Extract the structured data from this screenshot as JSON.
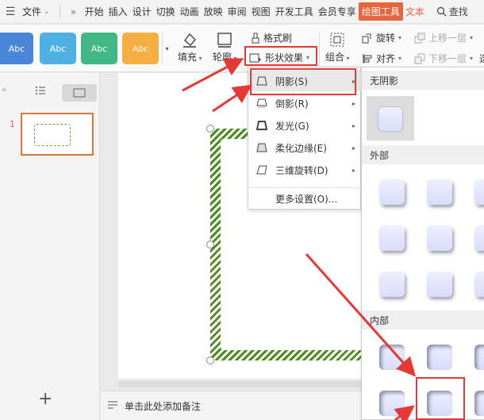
{
  "menubar": {
    "file": "文件",
    "tabs": [
      "开始",
      "插入",
      "设计",
      "切换",
      "动画",
      "放映",
      "审阅",
      "视图",
      "开发工具",
      "会员专享",
      "绘图工具",
      "文本"
    ],
    "search": "查找"
  },
  "ribbon": {
    "style_buttons": [
      {
        "label": "Abc",
        "color": "#4a86d8"
      },
      {
        "label": "Abc",
        "color": "#4fb0e3"
      },
      {
        "label": "Abc",
        "color": "#41b883"
      },
      {
        "label": "Abc",
        "color": "#f5b041"
      }
    ],
    "fill": "填充",
    "outline": "轮廓",
    "format_painter": "格式刷",
    "shape_effects": "形状效果",
    "group": "组合",
    "rotate": "旋转",
    "align": "对齐",
    "bring_forward": "上移一层",
    "send_backward": "下移一层",
    "select": "选"
  },
  "left_panel": {
    "slide_number": "1"
  },
  "notes": {
    "placeholder": "单击此处添加备注"
  },
  "dropdown": {
    "items": [
      "阴影(S)",
      "倒影(R)",
      "发光(G)",
      "柔化边缘(E)",
      "三维旋转(D)"
    ],
    "more": "更多设置(O)..."
  },
  "submenu": {
    "no_shadow": "无阴影",
    "outer": "外部",
    "inner": "内部"
  },
  "colors": {
    "accent": "#e8643c",
    "annotation": "#e53935"
  }
}
